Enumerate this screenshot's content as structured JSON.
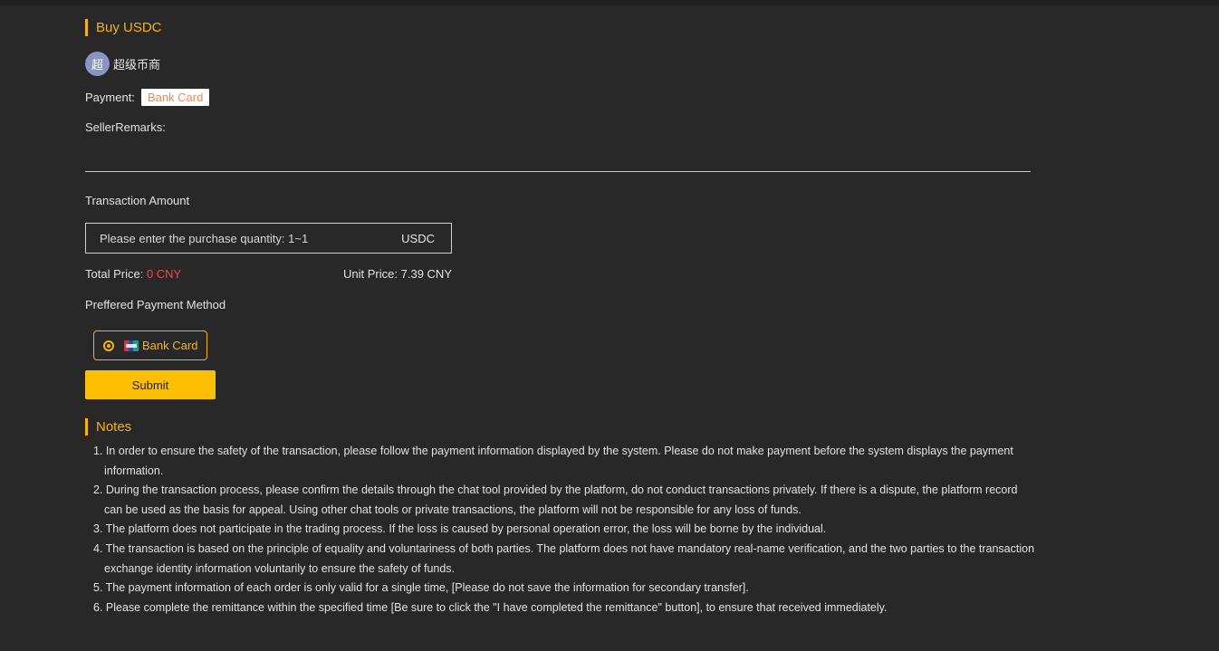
{
  "section": {
    "buy_title": "Buy USDC",
    "notes_title": "Notes"
  },
  "seller": {
    "avatar_char": "超",
    "name": "超级币商"
  },
  "payment": {
    "label": "Payment:",
    "tag": "Bank Card"
  },
  "seller_remarks_label": "SellerRemarks:",
  "transaction": {
    "label": "Transaction Amount",
    "placeholder": "Please enter the purchase quantity: 1~1",
    "unit": "USDC"
  },
  "price": {
    "total_label": "Total Price:",
    "total_value": "0 CNY",
    "unit_label": "Unit Price:",
    "unit_value": "7.39 CNY"
  },
  "preferred_method": {
    "label": "Preffered Payment Method",
    "option_label": "Bank Card",
    "option_selected": true
  },
  "submit_label": "Submit",
  "notes": [
    "1. In order to ensure the safety of the transaction, please follow the payment information displayed by the system. Please do not make payment before the system displays the payment information.",
    "2. During the transaction process, please confirm the details through the chat tool provided by the platform, do not conduct transactions privately. If there is a dispute, the platform record can be used as the basis for appeal. Using other chat tools or private transactions, the platform will not be responsible for any loss of funds.",
    "3. The platform does not participate in the trading process. If the loss is caused by personal operation error, the loss will be borne by the individual.",
    "4. The transaction is based on the principle of equality and voluntariness of both parties. The platform does not have mandatory real-name verification, and the two parties to the transaction exchange identity information voluntarily to ensure the safety of funds.",
    "5. The payment information of each order is only valid for a single time, [Please do not save the information for secondary transfer].",
    "6. Please complete the remittance within the specified time [Be sure to click the \"I have completed the remittance\" button], to ensure that received immediately."
  ],
  "colors": {
    "accent": "#f6b500",
    "button": "#fcc000",
    "total_price": "#f04848",
    "payment_tag_text": "#ee8a55",
    "background": "#282828"
  }
}
